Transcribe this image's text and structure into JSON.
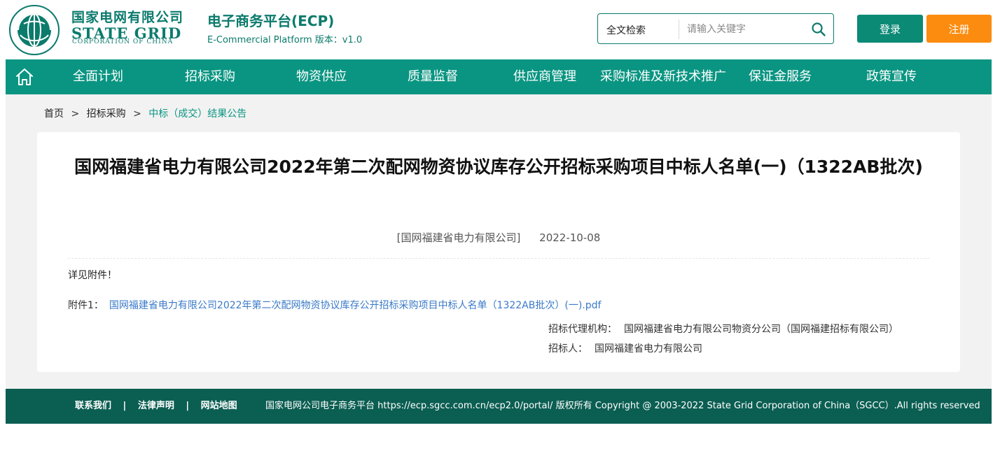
{
  "header": {
    "logo_text": "国家电网公司 STATE GRID CORPORATION OF CHINA",
    "brand_cn": "国家电网有限公司",
    "brand_en": "STATE GRID",
    "brand_en_sub": "CORPORATION OF CHINA",
    "platform_cn": "电子商务平台(ECP)",
    "platform_en": "E-Commercial Platform 版本：v1.0",
    "search": {
      "type_label": "全文检索",
      "placeholder": "请输入关键字",
      "value": ""
    },
    "login_label": "登录",
    "register_label": "注册"
  },
  "nav": {
    "items": [
      {
        "label": "全面计划"
      },
      {
        "label": "招标采购"
      },
      {
        "label": "物资供应"
      },
      {
        "label": "质量监督"
      },
      {
        "label": "供应商管理"
      },
      {
        "label": "采购标准及新技术推广"
      },
      {
        "label": "保证金服务"
      },
      {
        "label": "政策宣传"
      }
    ]
  },
  "breadcrumb": {
    "items": [
      "首页",
      "招标采购",
      "中标（成交）结果公告"
    ],
    "separator": ">"
  },
  "article": {
    "title": "国网福建省电力有限公司2022年第二次配网物资协议库存公开招标采购项目中标人名单(一)（1322AB批次)",
    "publisher": "[国网福建省电力有限公司]",
    "date": "2022-10-08",
    "body": "详见附件！",
    "attachment_label": "附件1：",
    "attachment_link": "国网福建省电力有限公司2022年第二次配网物资协议库存公开招标采购项目中标人名单（1322AB批次）(一).pdf",
    "agent_label": "招标代理机构：",
    "agent_value": "国网福建省电力有限公司物资分公司（国网福建招标有限公司）",
    "tenderer_label": "招标人：",
    "tenderer_value": "国网福建省电力有限公司"
  },
  "footer": {
    "links": [
      "联系我们",
      "法律声明",
      "网站地图"
    ],
    "link_separator": "|",
    "copyright": "国家电网公司电子商务平台 https://ecp.sgcc.com.cn/ecp2.0/portal/ 版权所有 Copyright @ 2003-2022 State Grid Corporation of China（SGCC）.All rights reserved"
  },
  "colors": {
    "brand_green": "#0b7b6c",
    "nav_green": "#0a9582",
    "footer_green": "#0b5e52",
    "register_orange": "#fb8c0f",
    "link_blue": "#3a7ac8"
  }
}
